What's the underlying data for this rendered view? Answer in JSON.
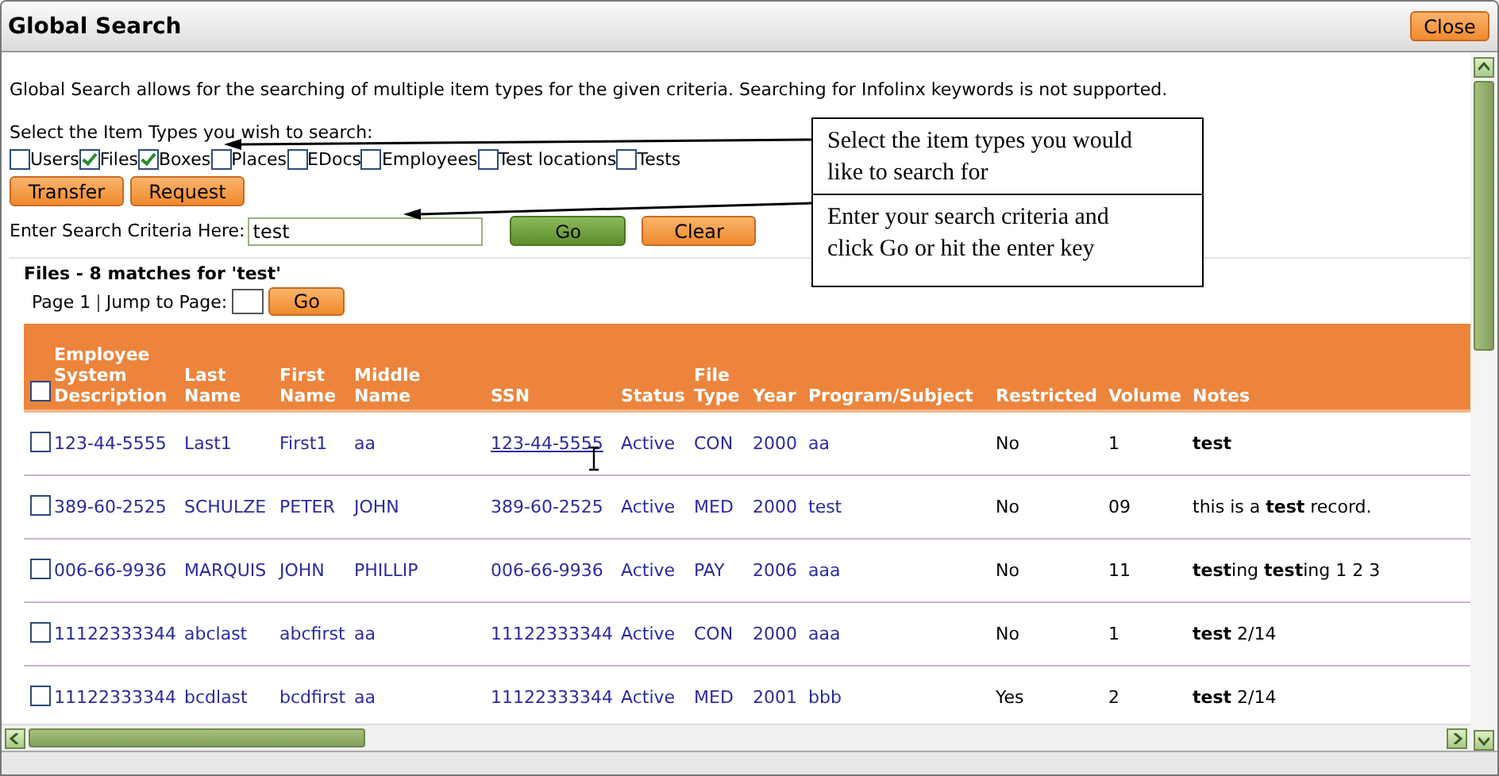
{
  "window": {
    "title": "Global Search",
    "close_button": "Close"
  },
  "description": "Global Search allows for the searching of multiple item types for the given criteria. Searching for Infolinx keywords is not supported.",
  "item_types": {
    "label": "Select the Item Types you wish to search:",
    "options": [
      {
        "label": "Users",
        "checked": false
      },
      {
        "label": "Files",
        "checked": true
      },
      {
        "label": "Boxes",
        "checked": true
      },
      {
        "label": "Places",
        "checked": false
      },
      {
        "label": "EDocs",
        "checked": false
      },
      {
        "label": "Employees",
        "checked": false
      },
      {
        "label": "Test locations",
        "checked": false
      },
      {
        "label": "Tests",
        "checked": false
      }
    ]
  },
  "action_buttons": [
    "Transfer",
    "Request"
  ],
  "search": {
    "label": "Enter Search Criteria Here:",
    "value": "test",
    "go_button": "Go",
    "clear_button": "Clear"
  },
  "results": {
    "heading": "Files - 8 matches for 'test'",
    "page_label": "Page 1",
    "page_separator": "|",
    "jump_label": "Jump to Page:",
    "jump_button": "Go",
    "select_all_checked": false,
    "columns": [
      "Employee System Description",
      "Last Name",
      "First Name",
      "Middle Name",
      "SSN",
      "Status",
      "File Type",
      "Year",
      "Program/Subject",
      "Restricted",
      "Volume",
      "Notes"
    ],
    "rows": [
      {
        "checked": false,
        "hovered_ssn": true,
        "cells": [
          "123-44-5555",
          "Last1",
          "First1",
          "aa",
          "123-44-5555",
          "Active",
          "CON",
          "2000",
          "aa",
          "No",
          "1",
          "**test**"
        ]
      },
      {
        "checked": false,
        "hovered_ssn": false,
        "cells": [
          "389-60-2525",
          "SCHULZE",
          "PETER",
          "JOHN",
          "389-60-2525",
          "Active",
          "MED",
          "2000",
          "test",
          "No",
          "09",
          "this is a **test** record."
        ]
      },
      {
        "checked": false,
        "hovered_ssn": false,
        "cells": [
          "006-66-9936",
          "MARQUIS",
          "JOHN",
          "PHILLIP",
          "006-66-9936",
          "Active",
          "PAY",
          "2006",
          "aaa",
          "No",
          "11",
          "**test**ing **test**ing 1 2 3"
        ]
      },
      {
        "checked": false,
        "hovered_ssn": false,
        "cells": [
          "11122333344",
          "abclast",
          "abcfirst",
          "aa",
          "11122333344",
          "Active",
          "CON",
          "2000",
          "aaa",
          "No",
          "1",
          "**test** 2/14"
        ]
      },
      {
        "checked": false,
        "hovered_ssn": false,
        "cells": [
          "11122333344",
          "bcdlast",
          "bcdfirst",
          "aa",
          "11122333344",
          "Active",
          "MED",
          "2001",
          "bbb",
          "Yes",
          "2",
          "**test** 2/14"
        ]
      }
    ]
  },
  "callouts": [
    {
      "text": "Select the item types you would like to search for"
    },
    {
      "text": "Enter your search criteria and click Go or hit the enter key"
    }
  ]
}
